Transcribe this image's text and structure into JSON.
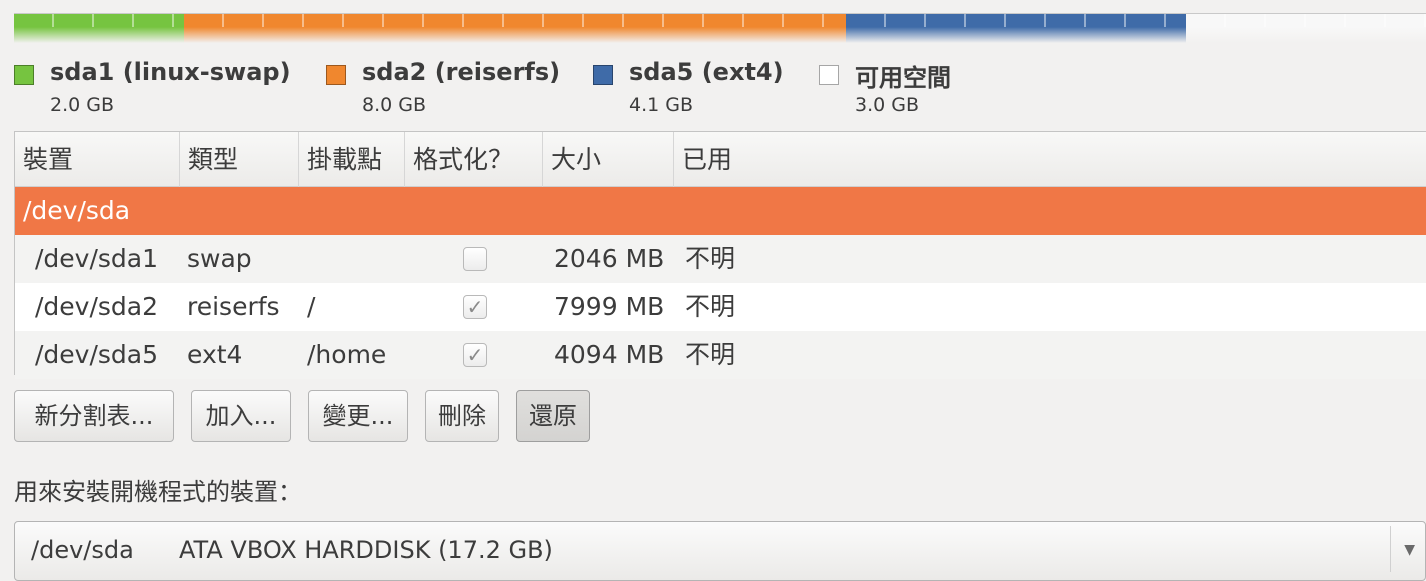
{
  "colors": {
    "swap": "#76c440",
    "reiserfs": "#f0872e",
    "ext4": "#3f6ba8",
    "free": "#ffffff",
    "selection": "#f07746"
  },
  "partition_bar": [
    {
      "name": "sda1",
      "color": "#76c440",
      "size_gb": 2.0
    },
    {
      "name": "sda2",
      "color": "#f0872e",
      "size_gb": 8.0
    },
    {
      "name": "sda5",
      "color": "#3f6ba8",
      "size_gb": 4.1
    },
    {
      "name": "free",
      "color": "#f8f8f8",
      "size_gb": 3.0
    }
  ],
  "legend": [
    {
      "label": "sda1 (linux-swap)",
      "size": "2.0 GB",
      "color": "#76c440"
    },
    {
      "label": "sda2 (reiserfs)",
      "size": "8.0 GB",
      "color": "#f0872e"
    },
    {
      "label": "sda5 (ext4)",
      "size": "4.1 GB",
      "color": "#3f6ba8"
    },
    {
      "label": "可用空間",
      "size": "3.0 GB",
      "color": "#ffffff"
    }
  ],
  "table": {
    "headers": {
      "device": "裝置",
      "type": "類型",
      "mount": "掛載點",
      "format": "格式化？",
      "size": "大小",
      "used": "已用"
    },
    "disk_row": {
      "device": "/dev/sda"
    },
    "rows": [
      {
        "device": "/dev/sda1",
        "type": "swap",
        "mount": "",
        "format": false,
        "size": "2046 MB",
        "used": "不明"
      },
      {
        "device": "/dev/sda2",
        "type": "reiserfs",
        "mount": "/",
        "format": true,
        "size": "7999 MB",
        "used": "不明"
      },
      {
        "device": "/dev/sda5",
        "type": "ext4",
        "mount": "/home",
        "format": true,
        "size": "4094 MB",
        "used": "不明"
      }
    ]
  },
  "buttons": {
    "new_table": "新分割表...",
    "add": "加入...",
    "change": "變更...",
    "delete": "刪除",
    "revert": "還原"
  },
  "boot_loader": {
    "label": "用來安裝開機程式的裝置：",
    "selected_device": "/dev/sda",
    "selected_desc": "ATA VBOX HARDDISK (17.2 GB)"
  },
  "icons": {
    "checkmark": "check-icon",
    "combo_arrow": "dropdown-arrow-icon"
  }
}
